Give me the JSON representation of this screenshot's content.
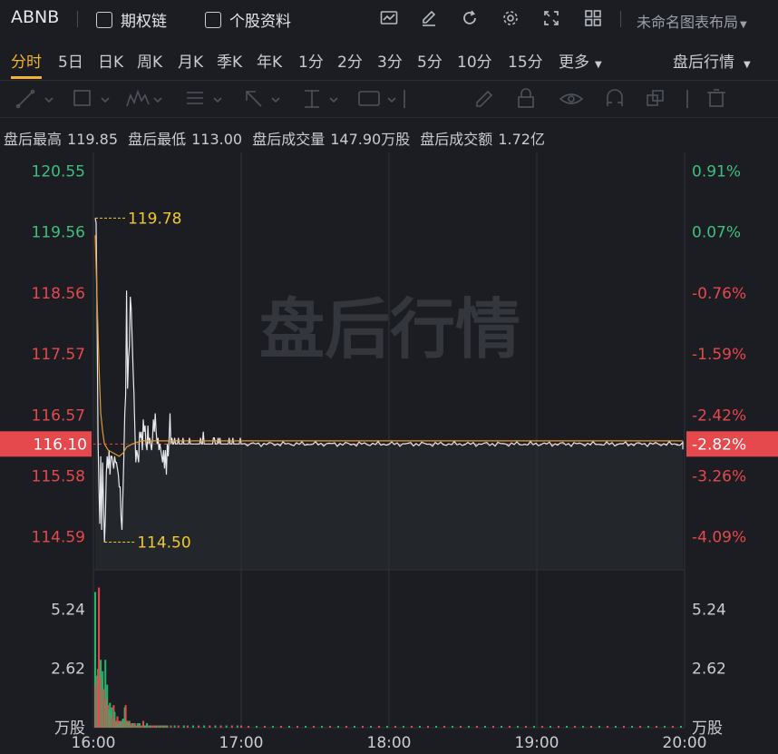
{
  "header": {
    "symbol": "ABNB",
    "options_chain": "期权链",
    "stock_info": "个股资料",
    "layout_name": "未命名图表布局"
  },
  "timeframes": [
    {
      "label": "分时",
      "active": true
    },
    {
      "label": "5日"
    },
    {
      "label": "日K"
    },
    {
      "label": "周K"
    },
    {
      "label": "月K"
    },
    {
      "label": "季K"
    },
    {
      "label": "年K"
    },
    {
      "label": "1分"
    },
    {
      "label": "2分"
    },
    {
      "label": "3分"
    },
    {
      "label": "5分"
    },
    {
      "label": "10分"
    },
    {
      "label": "15分"
    },
    {
      "label": "更多"
    }
  ],
  "session_select": "盘后行情",
  "stats": {
    "high_label": "盘后最高",
    "high": "119.85",
    "low_label": "盘后最低",
    "low": "113.00",
    "vol_label": "盘后成交量",
    "vol": "147.90万股",
    "amt_label": "盘后成交额",
    "amt": "1.72亿"
  },
  "chart_data": {
    "type": "line",
    "watermark": "盘后行情",
    "price_ticks": [
      "120.55",
      "119.56",
      "118.56",
      "117.57",
      "116.57",
      "115.58",
      "114.59"
    ],
    "pct_ticks": [
      "0.91%",
      "0.07%",
      "-0.76%",
      "-1.59%",
      "-2.42%",
      "-3.26%",
      "-4.09%"
    ],
    "current_price": "116.10",
    "current_pct": "-2.82%",
    "max_marker": "119.78",
    "min_marker": "114.50",
    "x_ticks": [
      "16:00",
      "17:00",
      "18:00",
      "19:00",
      "20:00"
    ],
    "volume_ticks": [
      "5.24",
      "2.62",
      "万股"
    ],
    "volume_ticks_right": [
      "5.24",
      "2.62",
      "万股"
    ],
    "colors": {
      "up": "#e5484d",
      "down": "#26b36b",
      "price": "#e6e8ec",
      "avg": "#e59a2f",
      "marker": "#f2c830"
    },
    "ylim": [
      114.05,
      120.85
    ],
    "price_series": [
      [
        0,
        119.78
      ],
      [
        1,
        119.7
      ],
      [
        2,
        118.3
      ],
      [
        3,
        116.2
      ],
      [
        4,
        115.4
      ],
      [
        5,
        114.8
      ],
      [
        6,
        115.9
      ],
      [
        7,
        114.7
      ],
      [
        8,
        115.8
      ],
      [
        9,
        115.1
      ],
      [
        10,
        114.5
      ],
      [
        11,
        114.9
      ],
      [
        12,
        115.6
      ],
      [
        13,
        115.9
      ],
      [
        14,
        115.7
      ],
      [
        15,
        116.0
      ],
      [
        16,
        115.6
      ],
      [
        17,
        115.9
      ],
      [
        18,
        115.9
      ],
      [
        19,
        115.8
      ],
      [
        20,
        115.7
      ],
      [
        21,
        115.9
      ],
      [
        22,
        115.8
      ],
      [
        23,
        115.8
      ],
      [
        24,
        115.7
      ],
      [
        25,
        115.6
      ],
      [
        26,
        115.4
      ],
      [
        27,
        115.4
      ],
      [
        28,
        114.9
      ],
      [
        29,
        114.7
      ],
      [
        30,
        115.3
      ],
      [
        31,
        115.9
      ],
      [
        32,
        116.6
      ],
      [
        33,
        116.9
      ],
      [
        34,
        118.6
      ],
      [
        35,
        117.0
      ],
      [
        36,
        117.5
      ],
      [
        37,
        117.7
      ],
      [
        38,
        118.5
      ],
      [
        39,
        118.3
      ],
      [
        40,
        117.8
      ],
      [
        41,
        117.3
      ],
      [
        42,
        116.9
      ],
      [
        43,
        116.3
      ],
      [
        44,
        115.8
      ],
      [
        45,
        116.0
      ],
      [
        46,
        115.9
      ],
      [
        47,
        115.8
      ],
      [
        48,
        116.3
      ],
      [
        49,
        116.2
      ],
      [
        50,
        116.3
      ],
      [
        51,
        116.0
      ],
      [
        52,
        116.5
      ],
      [
        53,
        116.3
      ],
      [
        54,
        116.4
      ],
      [
        55,
        116.1
      ],
      [
        56,
        116.0
      ],
      [
        57,
        116.4
      ],
      [
        58,
        116.1
      ],
      [
        59,
        116.2
      ],
      [
        60,
        116.1
      ],
      [
        61,
        116.0
      ],
      [
        62,
        116.2
      ],
      [
        63,
        116.5
      ],
      [
        64,
        116.3
      ],
      [
        65,
        116.6
      ],
      [
        66,
        116.3
      ],
      [
        67,
        116.1
      ],
      [
        68,
        116.2
      ],
      [
        69,
        116.0
      ],
      [
        70,
        116.1
      ],
      [
        71,
        116.0
      ],
      [
        72,
        115.9
      ],
      [
        73,
        115.8
      ],
      [
        74,
        116.0
      ],
      [
        75,
        115.7
      ],
      [
        76,
        116.0
      ],
      [
        77,
        115.6
      ],
      [
        78,
        116.1
      ],
      [
        79,
        115.9
      ],
      [
        80,
        116.2
      ],
      [
        81,
        116.6
      ],
      [
        82,
        116.1
      ],
      [
        83,
        116.2
      ],
      [
        84,
        116.1
      ],
      [
        85,
        116.1
      ],
      [
        86,
        116.2
      ],
      [
        87,
        116.1
      ],
      [
        88,
        116.1
      ],
      [
        89,
        116.1
      ],
      [
        90,
        116.2
      ],
      [
        91,
        116.1
      ],
      [
        92,
        116.1
      ],
      [
        93,
        116.1
      ],
      [
        94,
        116.1
      ],
      [
        95,
        116.2
      ],
      [
        96,
        116.1
      ],
      [
        97,
        116.1
      ],
      [
        98,
        116.1
      ],
      [
        99,
        116.1
      ],
      [
        100,
        116.1
      ],
      [
        101,
        116.1
      ],
      [
        102,
        116.2
      ],
      [
        103,
        116.1
      ],
      [
        104,
        116.1
      ],
      [
        105,
        116.1
      ],
      [
        106,
        116.1
      ],
      [
        107,
        116.1
      ],
      [
        108,
        116.1
      ],
      [
        109,
        116.1
      ],
      [
        110,
        116.1
      ],
      [
        111,
        116.1
      ],
      [
        112,
        116.1
      ],
      [
        113,
        116.1
      ],
      [
        114,
        116.2
      ],
      [
        115,
        116.1
      ],
      [
        116,
        116.1
      ],
      [
        117,
        116.3
      ],
      [
        118,
        116.1
      ],
      [
        119,
        116.1
      ],
      [
        120,
        116.1
      ],
      [
        121,
        116.1
      ],
      [
        122,
        116.1
      ],
      [
        123,
        116.1
      ],
      [
        124,
        116.1
      ],
      [
        125,
        116.1
      ],
      [
        126,
        116.1
      ],
      [
        127,
        116.1
      ],
      [
        128,
        116.2
      ],
      [
        129,
        116.2
      ],
      [
        130,
        116.1
      ],
      [
        131,
        116.1
      ],
      [
        132,
        116.1
      ],
      [
        133,
        116.2
      ],
      [
        134,
        116.1
      ],
      [
        135,
        116.2
      ],
      [
        136,
        116.1
      ],
      [
        137,
        116.1
      ],
      [
        138,
        116.1
      ],
      [
        139,
        116.1
      ],
      [
        140,
        116.1
      ],
      [
        141,
        116.1
      ],
      [
        142,
        116.1
      ],
      [
        143,
        116.1
      ],
      [
        144,
        116.1
      ],
      [
        145,
        116.2
      ],
      [
        146,
        116.1
      ],
      [
        147,
        116.1
      ],
      [
        148,
        116.1
      ],
      [
        149,
        116.2
      ],
      [
        150,
        116.1
      ],
      [
        151,
        116.1
      ],
      [
        152,
        116.1
      ],
      [
        153,
        116.1
      ],
      [
        154,
        116.1
      ],
      [
        155,
        116.1
      ],
      [
        156,
        116.1
      ],
      [
        157,
        116.2
      ],
      [
        158,
        116.1
      ],
      [
        159,
        116.1
      ]
    ],
    "avg_series": [
      [
        0,
        119.5
      ],
      [
        2,
        118.5
      ],
      [
        4,
        117.4
      ],
      [
        6,
        116.6
      ],
      [
        8,
        116.3
      ],
      [
        10,
        116.1
      ],
      [
        14,
        116.0
      ],
      [
        20,
        115.95
      ],
      [
        26,
        115.9
      ],
      [
        30,
        115.95
      ],
      [
        34,
        116.05
      ],
      [
        40,
        116.1
      ],
      [
        50,
        116.15
      ],
      [
        60,
        116.15
      ],
      [
        80,
        116.15
      ],
      [
        100,
        116.15
      ],
      [
        120,
        116.15
      ],
      [
        140,
        116.15
      ],
      [
        159,
        116.15
      ]
    ],
    "volume_max": 6.5,
    "volume_bars": [
      [
        0,
        6.0,
        "d"
      ],
      [
        1,
        1.9,
        "u"
      ],
      [
        2,
        2.3,
        "u"
      ],
      [
        3,
        2.6,
        "d"
      ],
      [
        4,
        6.2,
        "u"
      ],
      [
        5,
        2.8,
        "u"
      ],
      [
        6,
        3.0,
        "d"
      ],
      [
        7,
        2.2,
        "u"
      ],
      [
        8,
        2.5,
        "d"
      ],
      [
        9,
        1.7,
        "u"
      ],
      [
        10,
        1.2,
        "u"
      ],
      [
        11,
        3.0,
        "d"
      ],
      [
        12,
        1.3,
        "u"
      ],
      [
        13,
        1.9,
        "d"
      ],
      [
        14,
        1.0,
        "u"
      ],
      [
        15,
        0.8,
        "d"
      ],
      [
        16,
        1.1,
        "d"
      ],
      [
        17,
        0.6,
        "u"
      ],
      [
        18,
        0.9,
        "d"
      ],
      [
        19,
        0.4,
        "u"
      ],
      [
        20,
        1.0,
        "u"
      ],
      [
        21,
        0.7,
        "d"
      ],
      [
        22,
        0.3,
        "u"
      ],
      [
        23,
        0.3,
        "d"
      ],
      [
        24,
        0.5,
        "u"
      ],
      [
        25,
        0.2,
        "d"
      ],
      [
        26,
        0.3,
        "u"
      ],
      [
        27,
        0.2,
        "d"
      ],
      [
        28,
        0.3,
        "d"
      ],
      [
        29,
        0.3,
        "u"
      ],
      [
        30,
        0.4,
        "d"
      ],
      [
        31,
        0.2,
        "u"
      ],
      [
        32,
        0.9,
        "d"
      ],
      [
        33,
        1.0,
        "u"
      ],
      [
        34,
        0.3,
        "d"
      ],
      [
        35,
        0.3,
        "u"
      ],
      [
        36,
        0.2,
        "d"
      ],
      [
        37,
        0.3,
        "d"
      ],
      [
        38,
        0.2,
        "u"
      ],
      [
        39,
        0.1,
        "d"
      ],
      [
        40,
        0.2,
        "u"
      ],
      [
        41,
        0.2,
        "d"
      ],
      [
        42,
        0.1,
        "u"
      ],
      [
        43,
        0.2,
        "u"
      ],
      [
        44,
        0.1,
        "d"
      ],
      [
        45,
        0.1,
        "u"
      ],
      [
        46,
        0.2,
        "d"
      ],
      [
        47,
        0.1,
        "u"
      ],
      [
        48,
        0.2,
        "d"
      ],
      [
        50,
        0.1,
        "u"
      ],
      [
        52,
        0.3,
        "u"
      ],
      [
        54,
        0.1,
        "d"
      ],
      [
        56,
        0.2,
        "d"
      ],
      [
        58,
        0.1,
        "u"
      ],
      [
        60,
        0.1,
        "d"
      ],
      [
        62,
        0.1,
        "u"
      ],
      [
        64,
        0.1,
        "u"
      ],
      [
        66,
        0.1,
        "d"
      ],
      [
        68,
        0.1,
        "u"
      ],
      [
        70,
        0.1,
        "d"
      ],
      [
        72,
        0.1,
        "u"
      ],
      [
        74,
        0.1,
        "d"
      ],
      [
        76,
        0.1,
        "u"
      ],
      [
        78,
        0.1,
        "d"
      ],
      [
        82,
        0.1,
        "u"
      ],
      [
        86,
        0.1,
        "d"
      ],
      [
        90,
        0.1,
        "u"
      ],
      [
        96,
        0.1,
        "d"
      ],
      [
        100,
        0.1,
        "u"
      ],
      [
        106,
        0.1,
        "d"
      ],
      [
        112,
        0.1,
        "u"
      ],
      [
        118,
        0.1,
        "d"
      ],
      [
        124,
        0.1,
        "u"
      ],
      [
        130,
        0.1,
        "d"
      ],
      [
        136,
        0.1,
        "u"
      ],
      [
        142,
        0.1,
        "d"
      ],
      [
        148,
        0.1,
        "u"
      ],
      [
        154,
        0.1,
        "d"
      ],
      [
        158,
        0.1,
        "u"
      ]
    ]
  }
}
